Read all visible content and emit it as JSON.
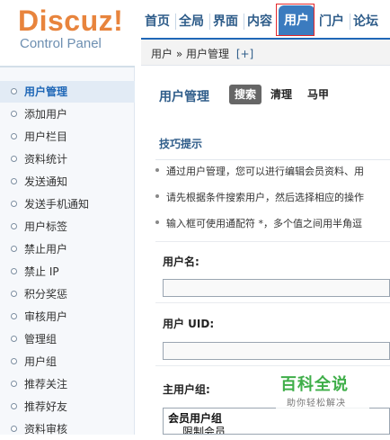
{
  "brand": {
    "logo": "Discuz!",
    "subtitle": "Control Panel"
  },
  "topnav": {
    "items": [
      "首页",
      "全局",
      "界面",
      "内容",
      "门户",
      "论坛"
    ],
    "active": "用户"
  },
  "breadcrumb": {
    "path": "用户 » 用户管理",
    "add": "[+]"
  },
  "sidebar": {
    "active": "用户管理",
    "items": [
      "添加用户",
      "用户栏目",
      "资料统计",
      "发送通知",
      "发送手机通知",
      "用户标签",
      "禁止用户",
      "禁止 IP",
      "积分奖惩",
      "审核用户",
      "管理组",
      "用户组",
      "推荐关注",
      "推荐好友",
      "资料审核"
    ]
  },
  "main": {
    "title": "用户管理",
    "tabs": [
      "搜索",
      "清理",
      "马甲"
    ],
    "tips": {
      "title": "技巧提示",
      "items": [
        "通过用户管理，您可以进行编辑会员资料、用",
        "请先根据条件搜索用户，然后选择相应的操作",
        "输入框可使用通配符 *，多个值之间用半角逗"
      ]
    },
    "form": {
      "username_label": "用户名:",
      "uid_label": "用户 UID:",
      "group_label": "主用户组:",
      "group_optgroup": "会员用户组",
      "group_option": "限制会员"
    }
  },
  "watermark": {
    "title": "百科全说",
    "subtitle": "助你轻松解决"
  },
  "colors": {
    "brand_orange": "#e8843d",
    "nav_blue": "#3b7bbf",
    "link_blue": "#2f5d8a",
    "watermark_green": "#3fae49"
  }
}
